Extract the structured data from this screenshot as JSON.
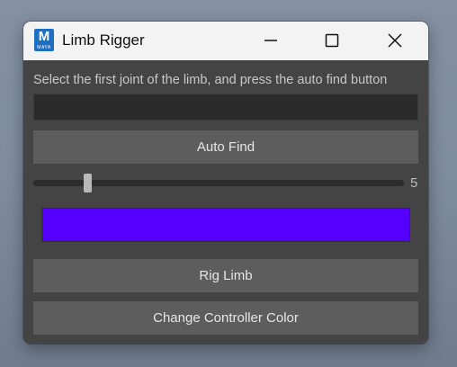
{
  "window": {
    "title": "Limb Rigger",
    "app_icon": {
      "letter": "M",
      "caption": "MAYA",
      "name": "maya-icon"
    },
    "controls": {
      "minimize": "minimize-icon",
      "maximize": "maximize-icon",
      "close": "close-icon"
    }
  },
  "main": {
    "instruction": "Select the first joint of the limb, and press the auto find button",
    "joint_field": {
      "value": ""
    },
    "auto_find_label": "Auto Find",
    "slider": {
      "value": "5",
      "fraction": 0.15
    },
    "controller_color": "#5500ff",
    "rig_limb_label": "Rig Limb",
    "change_color_label": "Change Controller Color"
  }
}
